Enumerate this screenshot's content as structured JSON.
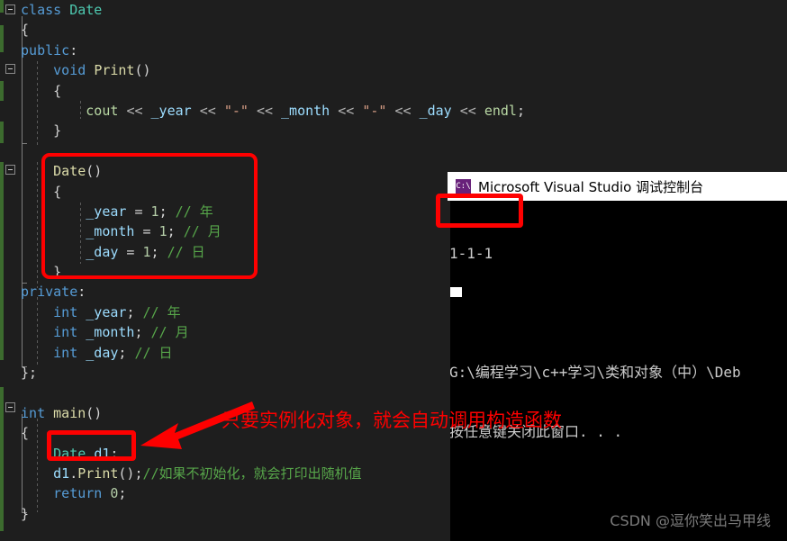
{
  "editor": {
    "background": "#1e1e1e",
    "lines": [
      {
        "indent": 0,
        "tokens": [
          {
            "t": "class",
            "c": "k-blue"
          },
          {
            "t": " ",
            "c": "k-punc"
          },
          {
            "t": "Date",
            "c": "k-type"
          }
        ]
      },
      {
        "indent": 0,
        "tokens": [
          {
            "t": "{",
            "c": "k-brace"
          }
        ]
      },
      {
        "indent": 0,
        "tokens": [
          {
            "t": "public",
            "c": "k-blue"
          },
          {
            "t": ":",
            "c": "k-punc"
          }
        ]
      },
      {
        "indent": 1,
        "tokens": [
          {
            "t": "void",
            "c": "k-blue"
          },
          {
            "t": " ",
            "c": "k-punc"
          },
          {
            "t": "Print",
            "c": "k-fn"
          },
          {
            "t": "()",
            "c": "k-punc"
          }
        ]
      },
      {
        "indent": 1,
        "tokens": [
          {
            "t": "{",
            "c": "k-brace"
          }
        ]
      },
      {
        "indent": 2,
        "tokens": [
          {
            "t": "cout",
            "c": "k-std"
          },
          {
            "t": " ",
            "c": "k-punc"
          },
          {
            "t": "<<",
            "c": "k-op"
          },
          {
            "t": " ",
            "c": "k-punc"
          },
          {
            "t": "_year",
            "c": "k-var"
          },
          {
            "t": " ",
            "c": "k-punc"
          },
          {
            "t": "<<",
            "c": "k-op"
          },
          {
            "t": " ",
            "c": "k-punc"
          },
          {
            "t": "\"-\"",
            "c": "k-str"
          },
          {
            "t": " ",
            "c": "k-punc"
          },
          {
            "t": "<<",
            "c": "k-op"
          },
          {
            "t": " ",
            "c": "k-punc"
          },
          {
            "t": "_month",
            "c": "k-var"
          },
          {
            "t": " ",
            "c": "k-punc"
          },
          {
            "t": "<<",
            "c": "k-op"
          },
          {
            "t": " ",
            "c": "k-punc"
          },
          {
            "t": "\"-\"",
            "c": "k-str"
          },
          {
            "t": " ",
            "c": "k-punc"
          },
          {
            "t": "<<",
            "c": "k-op"
          },
          {
            "t": " ",
            "c": "k-punc"
          },
          {
            "t": "_day",
            "c": "k-var"
          },
          {
            "t": " ",
            "c": "k-punc"
          },
          {
            "t": "<<",
            "c": "k-op"
          },
          {
            "t": " ",
            "c": "k-punc"
          },
          {
            "t": "endl",
            "c": "k-std"
          },
          {
            "t": ";",
            "c": "k-punc"
          }
        ]
      },
      {
        "indent": 1,
        "tokens": [
          {
            "t": "}",
            "c": "k-brace"
          }
        ]
      },
      {
        "indent": 0,
        "tokens": []
      },
      {
        "indent": 1,
        "tokens": [
          {
            "t": "Date",
            "c": "k-fn"
          },
          {
            "t": "()",
            "c": "k-punc"
          }
        ]
      },
      {
        "indent": 1,
        "tokens": [
          {
            "t": "{",
            "c": "k-brace"
          }
        ]
      },
      {
        "indent": 2,
        "tokens": [
          {
            "t": "_year",
            "c": "k-var"
          },
          {
            "t": " = ",
            "c": "k-punc"
          },
          {
            "t": "1",
            "c": "k-num"
          },
          {
            "t": "; ",
            "c": "k-punc"
          },
          {
            "t": "// 年",
            "c": "k-cmt"
          }
        ]
      },
      {
        "indent": 2,
        "tokens": [
          {
            "t": "_month",
            "c": "k-var"
          },
          {
            "t": " = ",
            "c": "k-punc"
          },
          {
            "t": "1",
            "c": "k-num"
          },
          {
            "t": "; ",
            "c": "k-punc"
          },
          {
            "t": "// 月",
            "c": "k-cmt"
          }
        ]
      },
      {
        "indent": 2,
        "tokens": [
          {
            "t": "_day",
            "c": "k-var"
          },
          {
            "t": " = ",
            "c": "k-punc"
          },
          {
            "t": "1",
            "c": "k-num"
          },
          {
            "t": "; ",
            "c": "k-punc"
          },
          {
            "t": "// 日",
            "c": "k-cmt"
          }
        ]
      },
      {
        "indent": 1,
        "tokens": [
          {
            "t": "}",
            "c": "k-brace"
          }
        ]
      },
      {
        "indent": 0,
        "tokens": [
          {
            "t": "private",
            "c": "k-blue"
          },
          {
            "t": ":",
            "c": "k-punc"
          }
        ]
      },
      {
        "indent": 1,
        "tokens": [
          {
            "t": "int",
            "c": "k-blue"
          },
          {
            "t": " ",
            "c": "k-punc"
          },
          {
            "t": "_year",
            "c": "k-var"
          },
          {
            "t": "; ",
            "c": "k-punc"
          },
          {
            "t": "// 年",
            "c": "k-cmt"
          }
        ]
      },
      {
        "indent": 1,
        "tokens": [
          {
            "t": "int",
            "c": "k-blue"
          },
          {
            "t": " ",
            "c": "k-punc"
          },
          {
            "t": "_month",
            "c": "k-var"
          },
          {
            "t": "; ",
            "c": "k-punc"
          },
          {
            "t": "// 月",
            "c": "k-cmt"
          }
        ]
      },
      {
        "indent": 1,
        "tokens": [
          {
            "t": "int",
            "c": "k-blue"
          },
          {
            "t": " ",
            "c": "k-punc"
          },
          {
            "t": "_day",
            "c": "k-var"
          },
          {
            "t": "; ",
            "c": "k-punc"
          },
          {
            "t": "// 日",
            "c": "k-cmt"
          }
        ]
      },
      {
        "indent": 0,
        "tokens": [
          {
            "t": "};",
            "c": "k-brace"
          }
        ]
      },
      {
        "indent": 0,
        "tokens": []
      },
      {
        "indent": 0,
        "tokens": [
          {
            "t": "int",
            "c": "k-blue"
          },
          {
            "t": " ",
            "c": "k-punc"
          },
          {
            "t": "main",
            "c": "k-fn"
          },
          {
            "t": "()",
            "c": "k-punc"
          }
        ]
      },
      {
        "indent": 0,
        "tokens": [
          {
            "t": "{",
            "c": "k-brace"
          }
        ]
      },
      {
        "indent": 1,
        "tokens": [
          {
            "t": "Date",
            "c": "k-type"
          },
          {
            "t": " ",
            "c": "k-punc"
          },
          {
            "t": "d1",
            "c": "k-var"
          },
          {
            "t": ";",
            "c": "k-punc"
          }
        ]
      },
      {
        "indent": 1,
        "tokens": [
          {
            "t": "d1",
            "c": "k-var"
          },
          {
            "t": ".",
            "c": "k-punc"
          },
          {
            "t": "Print",
            "c": "k-fn"
          },
          {
            "t": "();",
            "c": "k-punc"
          },
          {
            "t": "//如果不初始化，就会打印出随机值",
            "c": "k-cmt"
          }
        ]
      },
      {
        "indent": 1,
        "tokens": [
          {
            "t": "return",
            "c": "k-blue"
          },
          {
            "t": " ",
            "c": "k-punc"
          },
          {
            "t": "0",
            "c": "k-num"
          },
          {
            "t": ";",
            "c": "k-punc"
          }
        ]
      },
      {
        "indent": 0,
        "tokens": [
          {
            "t": "}",
            "c": "k-brace"
          }
        ]
      }
    ]
  },
  "annotations": {
    "color": "#fe0000",
    "constructor_box_label": "Date() constructor highlight",
    "object_box_label": "Date d1; highlight",
    "output_box_label": "1-1-1 output highlight",
    "note_text": "只要实例化对象，就会自动调用构造函数"
  },
  "console": {
    "title": "Microsoft Visual Studio 调试控制台",
    "icon": "console-icon",
    "icon_glyph": "C:\\",
    "output_line": "1-1-1",
    "path_line": "G:\\编程学习\\c++学习\\类和对象（中）\\Deb",
    "exit_line": "按任意键关闭此窗口. . .",
    "blank_line": ""
  },
  "watermark": {
    "text": "CSDN @逗你笑出马甲线"
  }
}
